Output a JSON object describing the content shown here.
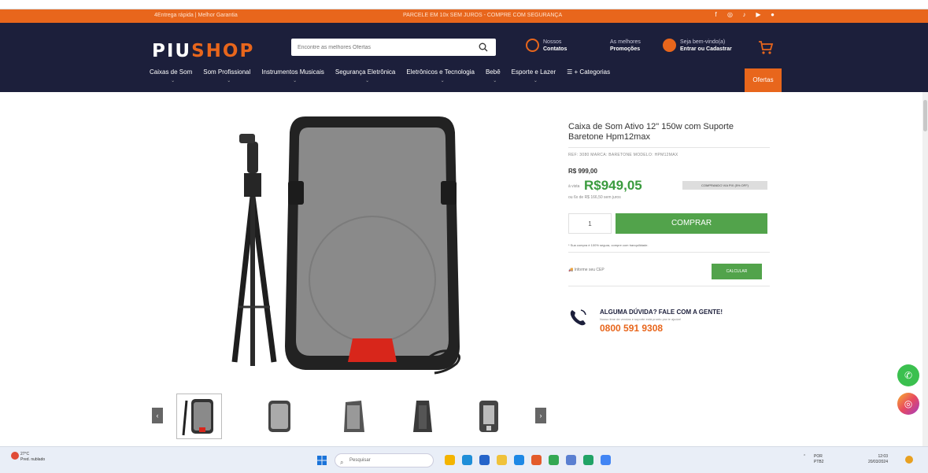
{
  "promo_bar": {
    "left_text": "4Entrega rápida | Melhor Garantia",
    "center_text": "PARCELE EM 10x SEM JUROS - COMPRE COM SEGURANÇA",
    "social_icons": [
      "facebook-icon",
      "instagram-icon",
      "tiktok-icon",
      "youtube-icon",
      "whatsapp-icon"
    ]
  },
  "header": {
    "logo_part1": "PIU",
    "logo_part2": "SHOP",
    "search_placeholder": "Encontre as melhores Ofertas",
    "contact": {
      "line1": "Nossos",
      "line2": "Contatos"
    },
    "promotions": {
      "line1": "As melhores",
      "line2": "Promoções"
    },
    "login": {
      "line1": "Seja bem-vindo(a)",
      "line2": "Entrar ou Cadastrar"
    }
  },
  "nav": {
    "items": [
      "Caixas de Som",
      "Som Profissional",
      "Instrumentos Musicais",
      "Segurança Eletrônica",
      "Eletrônicos e Tecnologia",
      "Bebê",
      "Esporte e Lazer"
    ],
    "all_categories": "☰ + Categorias",
    "offers": "Ofertas"
  },
  "product": {
    "title": "Caixa de Som Ativo 12\" 150w com Suporte Baretone Hpm12max",
    "ref_line": "REF: 3080   MARCA: BARETONE   MODELO: HPM12MAX",
    "old_price": "R$ 999,00",
    "cash_label": "à vista",
    "price": "R$949,05",
    "discount_badge": "COMPRANDO VIA PIX (5% OFF)",
    "installments": "ou 6x de R$ 166,50 sem juros",
    "quantity": "1",
    "buy_label": "COMPRAR",
    "security_note": "* Sua compra é 100% segura, compre com tranquilidade.",
    "shipping_placeholder": "Informe seu CEP",
    "calc_label": "CALCULAR",
    "help_question": "ALGUMA DÚVIDA? FALE COM A GENTE!",
    "help_sub": "Nosso time de vendas e suporte está pronto pra te ajudar!",
    "help_phone": "0800 591 9308",
    "speaker_brand": "Baretone"
  },
  "thumbnails": {
    "count": 5,
    "active_index": 0
  },
  "taskbar": {
    "weather_temp": "27°C",
    "weather_desc": "Pred. nublado",
    "search_label": "Pesquisar",
    "lang_line1": "POR",
    "lang_line2": "PTB2",
    "time": "12:03",
    "date": "20/03/2024"
  },
  "colors": {
    "accent": "#e8661c",
    "header_bg": "#1c1f3b",
    "buy_green": "#52a34b",
    "price_green": "#3a9b3e"
  }
}
